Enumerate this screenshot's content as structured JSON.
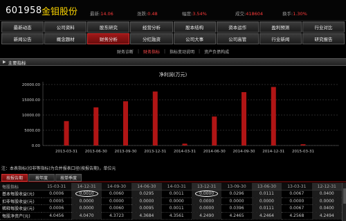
{
  "stock": {
    "code": "601958",
    "name": "金钼股份",
    "quotes": [
      {
        "label": "最新:",
        "value": "14.06"
      },
      {
        "label": "涨跌:",
        "value": "0.48"
      },
      {
        "label": "幅度:",
        "value": "3.54%"
      },
      {
        "label": "成交:",
        "value": "418604"
      },
      {
        "label": "换手:",
        "value": "1.30%"
      }
    ]
  },
  "nav": {
    "row1": [
      "最新动态",
      "公司资料",
      "股东研究",
      "经营分析",
      "股本结构",
      "资本运作",
      "盈利预测",
      "行业对比"
    ],
    "row2": [
      "新闻公告",
      "概念题材",
      "财务分析",
      "分红融资",
      "公司大事",
      "公司高管",
      "行业新闻",
      "研究报告"
    ],
    "active": "财务分析"
  },
  "subtabs": {
    "items": [
      "财务诊断",
      "财务指标",
      "指标变动说明",
      "资产负债构成"
    ],
    "selected": "财务指标"
  },
  "section": {
    "title": "主要指标"
  },
  "chart_data": {
    "type": "bar",
    "title": "净利润(万元)",
    "categories": [
      "2013-03-31",
      "2013-06-30",
      "2013-09-30",
      "2013-12-31",
      "2014-03-31",
      "2014-06-30",
      "2014-09-30",
      "2014-12-31",
      "2015-03-31"
    ],
    "values": [
      8000,
      12500,
      14500,
      17700,
      600,
      9500,
      17500,
      19200,
      400
    ],
    "yticks": [
      "20000.00",
      "15000.00",
      "10000.00",
      "5000.00",
      "0.00"
    ],
    "ylim": [
      0,
      20000
    ],
    "bar_color": "#b01515",
    "grid": true
  },
  "note": "注：本表指标(扣非等指标)为合并报表口径(按报告期)，单位元",
  "bottom_tabs": {
    "items": [
      "按报告期",
      "按年度",
      "按单季度"
    ],
    "active": "按报告期"
  },
  "table": {
    "header": [
      "每股指标",
      "15-03-31",
      "14-12-31",
      "14-09-30",
      "14-06-30",
      "14-03-31",
      "13-12-31",
      "13-09-30",
      "13-06-30",
      "13-03-31",
      "12-12-31"
    ],
    "rows": [
      [
        "基本每股收益(元)",
        "0.0006",
        "0.0010",
        "0.0060",
        "0.0295",
        "0.0011",
        "0.0000",
        "0.0296",
        "0.0111",
        "0.0067",
        "0.0400"
      ],
      [
        "扣非每股收益(元)",
        "0.0005",
        "0.0000",
        "0.0000",
        "0.0000",
        "0.0000",
        "0.0000",
        "0.0000",
        "0.0000",
        "0.0000",
        "0.0000"
      ],
      [
        "稀释每股收益(元)",
        "0.0006",
        "0.0000",
        "0.0060",
        "0.0095",
        "0.0011",
        "0.0000",
        "0.0396",
        "0.0111",
        "0.0067",
        "0.0400"
      ],
      [
        "每股净资产(元)",
        "4.0456",
        "4.0470",
        "4.3723",
        "4.3684",
        "4.3561",
        "4.2490",
        "4.2465",
        "4.2464",
        "4.2568",
        "4.2494"
      ]
    ]
  }
}
